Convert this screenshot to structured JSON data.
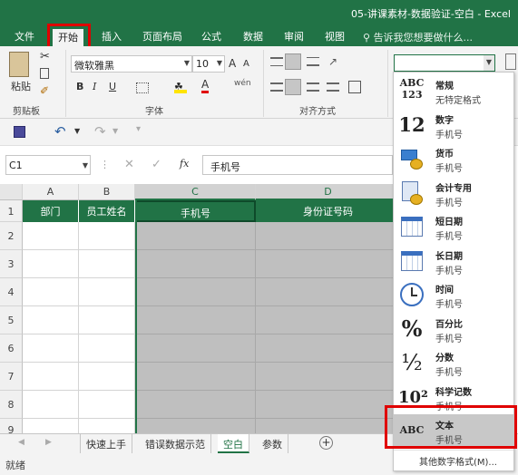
{
  "app": {
    "title": "05-讲课素材-数据验证-空白 - Excel"
  },
  "tabs": [
    "文件",
    "开始",
    "插入",
    "页面布局",
    "公式",
    "数据",
    "审阅",
    "视图"
  ],
  "tell_me": "告诉我您想要做什么...",
  "ribbon": {
    "paste_label": "粘贴",
    "clipboard_label": "剪贴板",
    "font_name": "微软雅黑",
    "font_size": "10",
    "font_group_label": "字体",
    "align_group_label": "对齐方式",
    "bold": "B",
    "italic": "I",
    "underline": "U",
    "grow_font": "A",
    "shrink_font": "A",
    "number_format_value": ""
  },
  "formula_bar": {
    "name_box": "C1",
    "fx": "fx",
    "content": "手机号"
  },
  "columns": [
    "A",
    "B",
    "C",
    "D"
  ],
  "rows": [
    "1",
    "2",
    "3",
    "4",
    "5",
    "6",
    "7",
    "8",
    "9"
  ],
  "header_row": [
    "部门",
    "员工姓名",
    "手机号",
    "身份证号码"
  ],
  "sheets": [
    "快速上手",
    "错误数据示范",
    "空白",
    "参数"
  ],
  "active_sheet": "空白",
  "status_text": "就绪",
  "number_formats": [
    {
      "icon": "ABC 123",
      "name": "常规",
      "example": "无特定格式"
    },
    {
      "icon": "12",
      "name": "数字",
      "example": "手机号"
    },
    {
      "icon": "currency",
      "name": "货币",
      "example": "手机号"
    },
    {
      "icon": "accounting",
      "name": "会计专用",
      "example": "手机号"
    },
    {
      "icon": "calendar",
      "name": "短日期",
      "example": "手机号"
    },
    {
      "icon": "calendar",
      "name": "长日期",
      "example": "手机号"
    },
    {
      "icon": "clock",
      "name": "时间",
      "example": "手机号"
    },
    {
      "icon": "%",
      "name": "百分比",
      "example": "手机号"
    },
    {
      "icon": "½",
      "name": "分数",
      "example": "手机号"
    },
    {
      "icon": "10²",
      "name": "科学记数",
      "example": "手机号"
    },
    {
      "icon": "ABC",
      "name": "文本",
      "example": "手机号"
    }
  ],
  "more_formats": "其他数字格式(M)...",
  "colors": {
    "excel_green": "#217346",
    "highlight_red": "#e00000",
    "selected_gray": "#bfbfbf"
  }
}
